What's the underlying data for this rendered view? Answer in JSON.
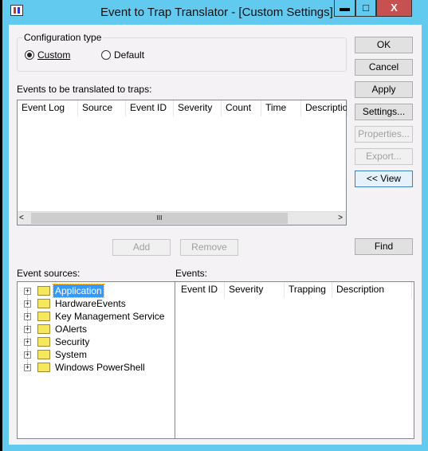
{
  "window": {
    "title": "Event to Trap Translator - [Custom Settings]",
    "minimize": "▬",
    "maximize": "□",
    "close": "X"
  },
  "config": {
    "label": "Configuration type",
    "custom": "Custom",
    "default": "Default",
    "selected": "Custom"
  },
  "events_label": "Events to be translated to traps:",
  "events_columns": [
    "Event Log",
    "Source",
    "Event ID",
    "Severity",
    "Count",
    "Time",
    "Description"
  ],
  "buttons": {
    "ok": "OK",
    "cancel": "Cancel",
    "apply": "Apply",
    "settings": "Settings...",
    "properties": "Properties...",
    "export": "Export...",
    "view": "<< View",
    "find": "Find",
    "add": "Add",
    "remove": "Remove"
  },
  "sources_label": "Event sources:",
  "sources": [
    "Application",
    "HardwareEvents",
    "Key Management Service",
    "OAlerts",
    "Security",
    "System",
    "Windows PowerShell"
  ],
  "selected_source": "Application",
  "events_pane_label": "Events:",
  "events_pane_columns": [
    "Event ID",
    "Severity",
    "Trapping",
    "Description"
  ],
  "scroll_thumb": "III"
}
